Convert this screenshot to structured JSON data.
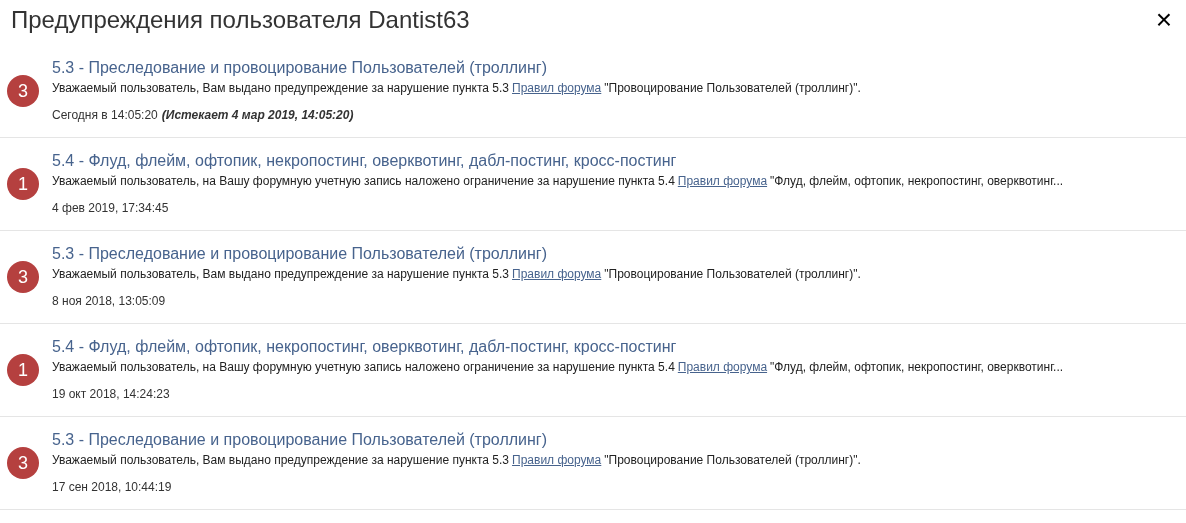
{
  "title": "Предупреждения пользователя Dantist63",
  "close": "×",
  "warnings": [
    {
      "points": "3",
      "heading": "5.3 - Преследование и провоцирование Пользователей (троллинг)",
      "text_before": "Уважаемый пользователь, Вам выдано предупреждение за нарушение пункта 5.3",
      "link": "Правил форума",
      "text_after": "\"Провоцирование Пользователей (троллинг)\".",
      "date": "Сегодня в 14:05:20",
      "expires": "(Истекает 4 мар 2019, 14:05:20)"
    },
    {
      "points": "1",
      "heading": "5.4 - Флуд, флейм, офтопик, некропостинг, оверквотинг, дабл-постинг, кросс-постинг",
      "text_before": "Уважаемый пользователь, на Вашу форумную учетную запись наложено ограничение за нарушение пункта 5.4",
      "link": "Правил форума",
      "text_after": "\"Флуд, флейм, офтопик, некропостинг, оверквотинг...",
      "date": "4 фев 2019, 17:34:45"
    },
    {
      "points": "3",
      "heading": "5.3 - Преследование и провоцирование Пользователей (троллинг)",
      "text_before": "Уважаемый пользователь, Вам выдано предупреждение за нарушение пункта 5.3",
      "link": "Правил форума",
      "text_after": "\"Провоцирование Пользователей (троллинг)\".",
      "date": "8 ноя 2018, 13:05:09"
    },
    {
      "points": "1",
      "heading": "5.4 - Флуд, флейм, офтопик, некропостинг, оверквотинг, дабл-постинг, кросс-постинг",
      "text_before": "Уважаемый пользователь, на Вашу форумную учетную запись наложено ограничение за нарушение пункта 5.4",
      "link": "Правил форума",
      "text_after": "\"Флуд, флейм, офтопик, некропостинг, оверквотинг...",
      "date": "19 окт 2018, 14:24:23"
    },
    {
      "points": "3",
      "heading": "5.3 - Преследование и провоцирование Пользователей (троллинг)",
      "text_before": "Уважаемый пользователь, Вам выдано предупреждение за нарушение пункта 5.3",
      "link": "Правил форума",
      "text_after": "\"Провоцирование Пользователей (троллинг)\".",
      "date": "17 сен 2018, 10:44:19"
    }
  ]
}
